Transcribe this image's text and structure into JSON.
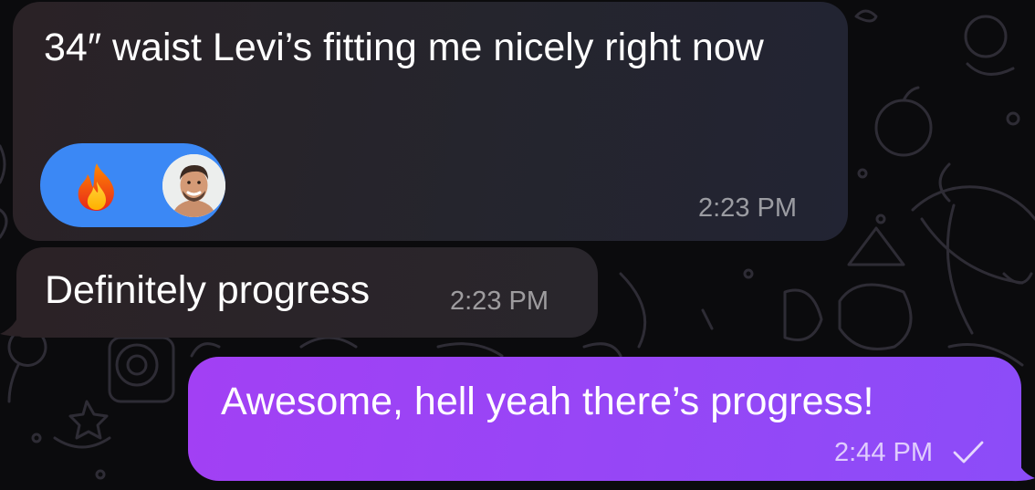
{
  "messages": [
    {
      "direction": "incoming",
      "text": "34″ waist Levi’s fitting me nicely right now",
      "time": "2:23 PM",
      "reaction": {
        "emoji": "🔥",
        "icon": "fire-icon",
        "color": "#3b88f5"
      }
    },
    {
      "direction": "incoming",
      "text": "Definitely progress",
      "time": "2:23 PM"
    },
    {
      "direction": "outgoing",
      "text": "Awesome, hell yeah there’s progress!",
      "time": "2:44 PM",
      "status_icon": "checkmark-icon",
      "color": "#9646f6"
    }
  ]
}
